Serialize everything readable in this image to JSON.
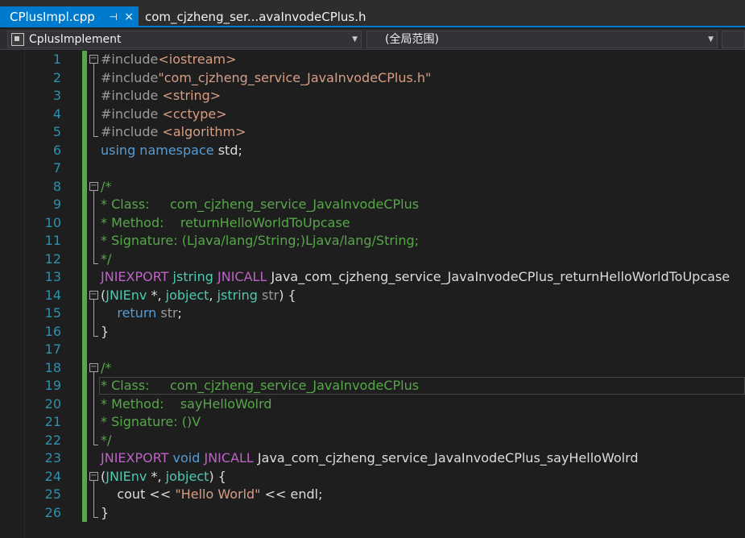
{
  "tabs": [
    {
      "label": "CPlusImpl.cpp",
      "active": true,
      "pin": "⊣",
      "close": "×"
    },
    {
      "label": "com_cjzheng_ser...avaInvodeCPlus.h",
      "active": false
    }
  ],
  "navbar": {
    "scope_dropdown": "CplusImplement",
    "member_dropdown": "(全局范围)"
  },
  "colors": {
    "accent": "#007acc",
    "changebar": "#57a64a",
    "linenumber": "#2b91af"
  },
  "code_lines": [
    {
      "n": "1",
      "fold": "−",
      "parts": [
        {
          "c": "pp",
          "t": "#include"
        },
        {
          "c": "st",
          "t": "<iostream>"
        }
      ]
    },
    {
      "n": "2",
      "parts": [
        {
          "c": "pp",
          "t": "#include"
        },
        {
          "c": "st",
          "t": "\"com_cjzheng_service_JavaInvodeCPlus.h\""
        }
      ]
    },
    {
      "n": "3",
      "parts": [
        {
          "c": "pp",
          "t": "#include "
        },
        {
          "c": "st",
          "t": "<string>"
        }
      ]
    },
    {
      "n": "4",
      "parts": [
        {
          "c": "pp",
          "t": "#include "
        },
        {
          "c": "st",
          "t": "<cctype>"
        }
      ]
    },
    {
      "n": "5",
      "parts": [
        {
          "c": "pp",
          "t": "#include "
        },
        {
          "c": "st",
          "t": "<algorithm>"
        }
      ]
    },
    {
      "n": "6",
      "parts": [
        {
          "c": "kw",
          "t": "using namespace "
        },
        {
          "c": "fn",
          "t": "std;"
        }
      ]
    },
    {
      "n": "7",
      "parts": []
    },
    {
      "n": "8",
      "fold": "−",
      "parts": [
        {
          "c": "cm",
          "t": "/*"
        }
      ]
    },
    {
      "n": "9",
      "parts": [
        {
          "c": "cm",
          "t": "* Class:     com_cjzheng_service_JavaInvodeCPlus"
        }
      ]
    },
    {
      "n": "10",
      "parts": [
        {
          "c": "cm",
          "t": "* Method:    returnHelloWorldToUpcase"
        }
      ]
    },
    {
      "n": "11",
      "parts": [
        {
          "c": "cm",
          "t": "* Signature: (Ljava/lang/String;)Ljava/lang/String;"
        }
      ]
    },
    {
      "n": "12",
      "parts": [
        {
          "c": "cm",
          "t": "*/"
        }
      ]
    },
    {
      "n": "13",
      "parts": [
        {
          "c": "mc",
          "t": "JNIEXPORT "
        },
        {
          "c": "ty",
          "t": "jstring "
        },
        {
          "c": "mc",
          "t": "JNICALL "
        },
        {
          "c": "fn",
          "t": "Java_com_cjzheng_service_JavaInvodeCPlus_returnHelloWorldToUpcase"
        }
      ]
    },
    {
      "n": "14",
      "fold": "−",
      "parts": [
        {
          "c": "fn",
          "t": "("
        },
        {
          "c": "ty",
          "t": "JNIEnv"
        },
        {
          "c": "fn",
          "t": " *, "
        },
        {
          "c": "ty",
          "t": "jobject"
        },
        {
          "c": "fn",
          "t": ", "
        },
        {
          "c": "ty",
          "t": "jstring"
        },
        {
          "c": "pa",
          "t": " str"
        },
        {
          "c": "fn",
          "t": ") {"
        }
      ]
    },
    {
      "n": "15",
      "parts": [
        {
          "c": "kw",
          "t": "    return "
        },
        {
          "c": "pa",
          "t": "str"
        },
        {
          "c": "fn",
          "t": ";"
        }
      ]
    },
    {
      "n": "16",
      "parts": [
        {
          "c": "fn",
          "t": "}"
        }
      ]
    },
    {
      "n": "17",
      "parts": []
    },
    {
      "n": "18",
      "fold": "−",
      "parts": [
        {
          "c": "cm",
          "t": "/*"
        }
      ]
    },
    {
      "n": "19",
      "parts": [
        {
          "c": "cm",
          "t": "* Class:     com_cjzheng_service_JavaInvodeCPlus"
        }
      ]
    },
    {
      "n": "20",
      "parts": [
        {
          "c": "cm",
          "t": "* Method:    sayHelloWolrd"
        }
      ]
    },
    {
      "n": "21",
      "parts": [
        {
          "c": "cm",
          "t": "* Signature: ()V"
        }
      ]
    },
    {
      "n": "22",
      "parts": [
        {
          "c": "cm",
          "t": "*/"
        }
      ]
    },
    {
      "n": "23",
      "parts": [
        {
          "c": "mc",
          "t": "JNIEXPORT "
        },
        {
          "c": "kw",
          "t": "void "
        },
        {
          "c": "mc",
          "t": "JNICALL "
        },
        {
          "c": "fn",
          "t": "Java_com_cjzheng_service_JavaInvodeCPlus_sayHelloWolrd"
        }
      ]
    },
    {
      "n": "24",
      "fold": "−",
      "parts": [
        {
          "c": "fn",
          "t": "("
        },
        {
          "c": "ty",
          "t": "JNIEnv"
        },
        {
          "c": "fn",
          "t": " *, "
        },
        {
          "c": "ty",
          "t": "jobject"
        },
        {
          "c": "fn",
          "t": ") {"
        }
      ]
    },
    {
      "n": "25",
      "parts": [
        {
          "c": "fn",
          "t": "    cout << "
        },
        {
          "c": "st",
          "t": "\"Hello World\""
        },
        {
          "c": "fn",
          "t": " << endl;"
        }
      ]
    },
    {
      "n": "26",
      "parts": [
        {
          "c": "fn",
          "t": "}"
        }
      ]
    }
  ],
  "editor": {
    "current_line": "19"
  }
}
